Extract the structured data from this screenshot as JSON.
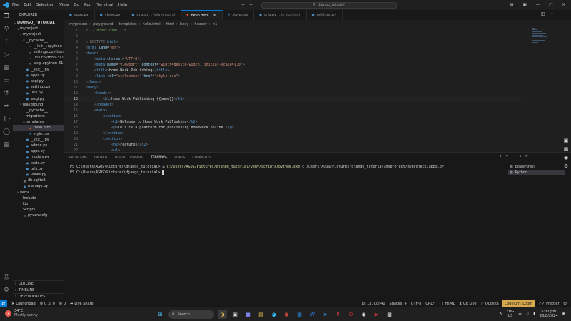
{
  "window": {
    "title": "django_tutorial"
  },
  "menu": [
    "File",
    "Edit",
    "Selection",
    "View",
    "Go",
    "Run",
    "Terminal",
    "Help"
  ],
  "explorer": {
    "header": "EXPLORER",
    "root": "DJANGO_TUTORIAL",
    "items": [
      {
        "label": "myproject",
        "depth": 1,
        "kind": "folder",
        "open": true
      },
      {
        "label": "myproject",
        "depth": 2,
        "kind": "folder",
        "open": true
      },
      {
        "label": "__pycache__",
        "depth": 3,
        "kind": "folder",
        "open": true
      },
      {
        "label": "__init__.cpython-3...",
        "depth": 4,
        "kind": "pyc"
      },
      {
        "label": "settings.cpython-...",
        "depth": 4,
        "kind": "pyc"
      },
      {
        "label": "urls.cpython-311...",
        "depth": 4,
        "kind": "pyc"
      },
      {
        "label": "wsgi.cpython-311...",
        "depth": 4,
        "kind": "pyc"
      },
      {
        "label": "__init__.py",
        "depth": 3,
        "kind": "py"
      },
      {
        "label": "apps.py",
        "depth": 3,
        "kind": "py"
      },
      {
        "label": "asgi.py",
        "depth": 3,
        "kind": "py"
      },
      {
        "label": "settings.py",
        "depth": 3,
        "kind": "py"
      },
      {
        "label": "urls.py",
        "depth": 3,
        "kind": "py"
      },
      {
        "label": "wsgi.py",
        "depth": 3,
        "kind": "py"
      },
      {
        "label": "playground",
        "depth": 2,
        "kind": "folder",
        "open": true
      },
      {
        "label": "__pycache__",
        "depth": 3,
        "kind": "folder",
        "open": false
      },
      {
        "label": "migrations",
        "depth": 3,
        "kind": "folder",
        "open": false
      },
      {
        "label": "templates",
        "depth": 3,
        "kind": "folder",
        "open": true
      },
      {
        "label": "hello.html",
        "depth": 4,
        "kind": "html",
        "selected": true
      },
      {
        "label": "style.css",
        "depth": 4,
        "kind": "css"
      },
      {
        "label": "__init__.py",
        "depth": 3,
        "kind": "py"
      },
      {
        "label": "admin.py",
        "depth": 3,
        "kind": "py"
      },
      {
        "label": "apps.py",
        "depth": 3,
        "kind": "py"
      },
      {
        "label": "models.py",
        "depth": 3,
        "kind": "py"
      },
      {
        "label": "tests.py",
        "depth": 3,
        "kind": "py"
      },
      {
        "label": "urls.py",
        "depth": 3,
        "kind": "py"
      },
      {
        "label": "views.py",
        "depth": 3,
        "kind": "py"
      },
      {
        "label": "db.sqlite3",
        "depth": 2,
        "kind": "db"
      },
      {
        "label": "manage.py",
        "depth": 2,
        "kind": "py"
      },
      {
        "label": "venv",
        "depth": 1,
        "kind": "folder",
        "open": true
      },
      {
        "label": "Include",
        "depth": 2,
        "kind": "folder",
        "open": false
      },
      {
        "label": "Lib",
        "depth": 2,
        "kind": "folder",
        "open": false
      },
      {
        "label": "Scripts",
        "depth": 2,
        "kind": "folder",
        "open": false
      },
      {
        "label": "pyvenv.cfg",
        "depth": 2,
        "kind": "cfg"
      }
    ],
    "sections": [
      "OUTLINE",
      "TIMELINE",
      "DEPENDENCIES"
    ]
  },
  "tabs": [
    {
      "label": "apps.py",
      "desc": "",
      "kind": "py",
      "active": false
    },
    {
      "label": "views.py",
      "desc": "",
      "kind": "py",
      "active": false
    },
    {
      "label": "urls.py",
      "desc": "...\\playground",
      "kind": "py",
      "active": false
    },
    {
      "label": "hello.html",
      "desc": "",
      "kind": "html",
      "active": true
    },
    {
      "label": "style.css",
      "desc": "",
      "kind": "css",
      "active": false
    },
    {
      "label": "urls.py",
      "desc": "...\\myproject",
      "kind": "py",
      "active": false
    },
    {
      "label": "settings.py",
      "desc": "",
      "kind": "py",
      "active": false
    }
  ],
  "breadcrumb": [
    "myproject",
    "playground",
    "templates",
    "hello.html",
    "html",
    "body",
    "header",
    "h1"
  ],
  "editor": {
    "current_line": 13,
    "lines": [
      {
        "n": "1",
        "tokens": [
          [
            "<!-- index.html -->",
            "#6a9955"
          ]
        ]
      },
      {
        "n": "2",
        "tokens": []
      },
      {
        "n": "3",
        "tokens": [
          [
            "<!DOCTYPE ",
            "#808080"
          ],
          [
            "html",
            "#569cd6"
          ],
          [
            ">",
            "#808080"
          ]
        ]
      },
      {
        "n": "4",
        "tokens": [
          [
            "<",
            "#808080"
          ],
          [
            "html ",
            "#569cd6"
          ],
          [
            "lang",
            "#9cdcfe"
          ],
          [
            "=",
            "#d4d4d4"
          ],
          [
            "\"en\"",
            "#ce9178"
          ],
          [
            ">",
            "#808080"
          ]
        ]
      },
      {
        "n": "5",
        "tokens": [
          [
            "<",
            "#808080"
          ],
          [
            "head",
            "#569cd6"
          ],
          [
            ">",
            "#808080"
          ]
        ]
      },
      {
        "n": "6",
        "tokens": [
          [
            "    <",
            "#808080"
          ],
          [
            "meta ",
            "#569cd6"
          ],
          [
            "charset",
            "#9cdcfe"
          ],
          [
            "=",
            "#d4d4d4"
          ],
          [
            "\"UTF-8\"",
            "#ce9178"
          ],
          [
            ">",
            "#808080"
          ]
        ]
      },
      {
        "n": "7",
        "tokens": [
          [
            "    <",
            "#808080"
          ],
          [
            "meta ",
            "#569cd6"
          ],
          [
            "name",
            "#9cdcfe"
          ],
          [
            "=",
            "#d4d4d4"
          ],
          [
            "\"viewport\" ",
            "#ce9178"
          ],
          [
            "content",
            "#9cdcfe"
          ],
          [
            "=",
            "#d4d4d4"
          ],
          [
            "\"width=device-width, initial-scale=1.0\"",
            "#ce9178"
          ],
          [
            ">",
            "#808080"
          ]
        ]
      },
      {
        "n": "8",
        "tokens": [
          [
            "    <",
            "#808080"
          ],
          [
            "title",
            "#569cd6"
          ],
          [
            ">",
            "#808080"
          ],
          [
            "Home Work Publishing",
            "#d4d4d4"
          ],
          [
            "</",
            "#808080"
          ],
          [
            "title",
            "#569cd6"
          ],
          [
            ">",
            "#808080"
          ]
        ]
      },
      {
        "n": "9",
        "tokens": [
          [
            "    <",
            "#808080"
          ],
          [
            "link ",
            "#569cd6"
          ],
          [
            "rel",
            "#9cdcfe"
          ],
          [
            "=",
            "#d4d4d4"
          ],
          [
            "\"stylesheet\" ",
            "#ce9178"
          ],
          [
            "href",
            "#9cdcfe"
          ],
          [
            "=",
            "#d4d4d4"
          ],
          [
            "\"style.css\"",
            "#ce9178"
          ],
          [
            ">",
            "#808080"
          ]
        ]
      },
      {
        "n": "10",
        "tokens": [
          [
            "</",
            "#808080"
          ],
          [
            "head",
            "#569cd6"
          ],
          [
            ">",
            "#808080"
          ]
        ]
      },
      {
        "n": "11",
        "tokens": [
          [
            "<",
            "#808080"
          ],
          [
            "body",
            "#569cd6"
          ],
          [
            ">",
            "#808080"
          ]
        ]
      },
      {
        "n": "12",
        "tokens": [
          [
            "    <",
            "#808080"
          ],
          [
            "header",
            "#569cd6"
          ],
          [
            ">",
            "#808080"
          ]
        ]
      },
      {
        "n": "13",
        "tokens": [
          [
            "        <",
            "#808080"
          ],
          [
            "h1",
            "#569cd6"
          ],
          [
            ">",
            "#808080"
          ],
          [
            "Home Work Publishing {{name}}",
            "#d4d4d4"
          ],
          [
            "</",
            "#808080"
          ],
          [
            "h1",
            "#569cd6"
          ],
          [
            ">",
            "#808080"
          ]
        ]
      },
      {
        "n": "14",
        "tokens": [
          [
            "    </",
            "#808080"
          ],
          [
            "header",
            "#569cd6"
          ],
          [
            ">",
            "#808080"
          ]
        ]
      },
      {
        "n": "15",
        "tokens": [
          [
            "    <",
            "#808080"
          ],
          [
            "main",
            "#569cd6"
          ],
          [
            ">",
            "#808080"
          ]
        ]
      },
      {
        "n": "16",
        "tokens": [
          [
            "        <",
            "#808080"
          ],
          [
            "section",
            "#569cd6"
          ],
          [
            ">",
            "#808080"
          ]
        ]
      },
      {
        "n": "17",
        "tokens": [
          [
            "            <",
            "#808080"
          ],
          [
            "h2",
            "#569cd6"
          ],
          [
            ">",
            "#808080"
          ],
          [
            "Welcome to Home Work Publishing",
            "#d4d4d4"
          ],
          [
            "</",
            "#808080"
          ],
          [
            "h2",
            "#569cd6"
          ],
          [
            ">",
            "#808080"
          ]
        ]
      },
      {
        "n": "18",
        "tokens": [
          [
            "            <",
            "#808080"
          ],
          [
            "p",
            "#569cd6"
          ],
          [
            ">",
            "#808080"
          ],
          [
            "This is a platform for publishing homework online.",
            "#d4d4d4"
          ],
          [
            "</",
            "#808080"
          ],
          [
            "p",
            "#569cd6"
          ],
          [
            ">",
            "#808080"
          ]
        ]
      },
      {
        "n": "19",
        "tokens": [
          [
            "        </",
            "#808080"
          ],
          [
            "section",
            "#569cd6"
          ],
          [
            ">",
            "#808080"
          ]
        ]
      },
      {
        "n": "20",
        "tokens": [
          [
            "        <",
            "#808080"
          ],
          [
            "section",
            "#569cd6"
          ],
          [
            ">",
            "#808080"
          ]
        ]
      },
      {
        "n": "21",
        "tokens": [
          [
            "            <",
            "#808080"
          ],
          [
            "h2",
            "#569cd6"
          ],
          [
            ">",
            "#808080"
          ],
          [
            "Features",
            "#d4d4d4"
          ],
          [
            "</",
            "#808080"
          ],
          [
            "h2",
            "#569cd6"
          ],
          [
            ">",
            "#808080"
          ]
        ]
      },
      {
        "n": "22",
        "tokens": [
          [
            "            <",
            "#808080"
          ],
          [
            "ul",
            "#569cd6"
          ],
          [
            ">",
            "#808080"
          ]
        ]
      }
    ]
  },
  "panel": {
    "tabs": [
      "PROBLEMS",
      "OUTPUT",
      "DEBUG CONSOLE",
      "TERMINAL",
      "PORTS",
      "COMMENTS"
    ],
    "active_tab": "TERMINAL",
    "terminal": {
      "line1_prompt": "PS C:\\Users\\AGUS\\Pictures\\django_tutorial> & ",
      "line1_exe": "c:/Users/AGUS/Pictures/django_tutorial/venv/Scripts/python.exe",
      "line1_arg": " c:/Users/AGUS/Pictures/django_tutorial/myproject/myproject/apps.py",
      "line2_prompt": "PS C:\\Users\\AGUS\\Pictures\\django_tutorial> "
    },
    "terminal_list": [
      "powershell",
      "Python"
    ]
  },
  "statusbar": {
    "launchpad": "Launchpad",
    "errors": "0",
    "warnings": "0",
    "ports": "0",
    "live_share": "Live Share",
    "position": "Ln 13, Col 40",
    "spaces": "Spaces: 4",
    "encoding": "UTF-8",
    "eol": "CRLF",
    "language": "HTML",
    "go_live": "Go Live",
    "quokka": "Quokka",
    "codeium": "Codeium: Login",
    "prettier": "Prettier"
  },
  "taskbar": {
    "weather_temp": "34°C",
    "weather_desc": "Mostly sunny",
    "search_placeholder": "Search",
    "lang_top": "ENG",
    "lang_bottom": "US",
    "time": "5:02 pm",
    "date": "28/8/2024"
  },
  "colors": {
    "accent": "#0078d4",
    "codeium": "#d7a94a"
  }
}
